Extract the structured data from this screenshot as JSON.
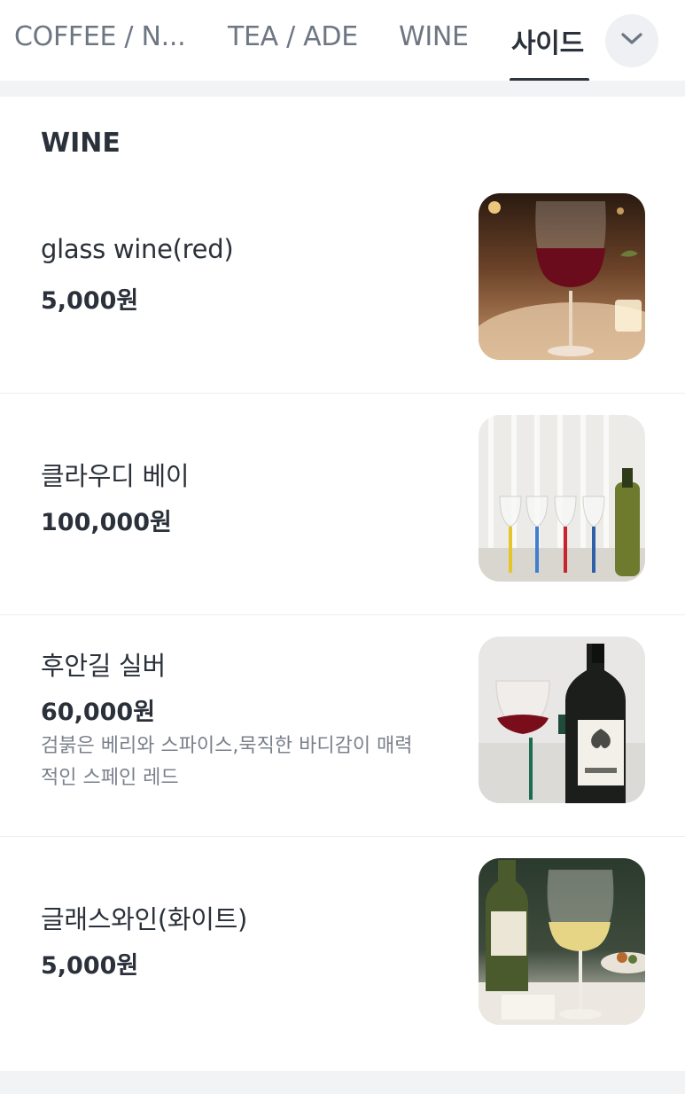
{
  "tabs": [
    {
      "label": "COFFEE / N..."
    },
    {
      "label": "TEA / ADE"
    },
    {
      "label": "WINE"
    },
    {
      "label": "사이드"
    }
  ],
  "active_tab": "사이드",
  "toggle_icon": "chevron-down-icon",
  "section": {
    "title": "WINE",
    "items": [
      {
        "name": "glass wine(red)",
        "price": "5,000원",
        "image": "red-wine-glass-photo"
      },
      {
        "name": "클라우디 베이",
        "price": "100,000원",
        "image": "colored-stem-glasses-photo"
      },
      {
        "name": "후안길 실버",
        "price": "60,000원",
        "description": "검붉은 베리와 스파이스,묵직한 바디감이 매력적인 스페인 레드",
        "image": "juan-gil-bottle-photo"
      },
      {
        "name": "글래스와인(화이트)",
        "price": "5,000원",
        "image": "white-wine-glass-photo"
      }
    ]
  },
  "colors": {
    "text_primary": "#2b313a",
    "text_secondary": "#7a818c",
    "tab_inactive": "#6d7683",
    "separator": "#f2f3f5"
  }
}
